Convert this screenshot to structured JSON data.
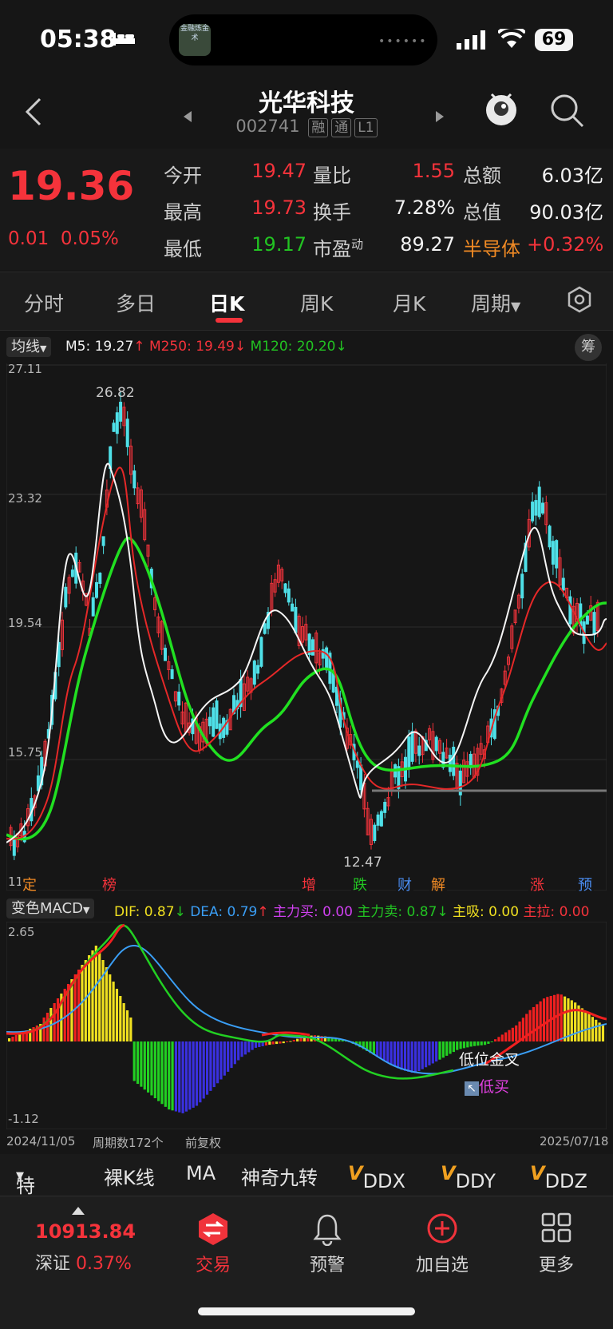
{
  "status": {
    "time": "05:38",
    "battery": "69",
    "island_app": "金融炼金术"
  },
  "header": {
    "title": "光华科技",
    "code": "002741",
    "tags": [
      "融",
      "通",
      "L1"
    ]
  },
  "quote": {
    "price": "19.36",
    "change": "0.01",
    "change_pct": "0.05%",
    "rows": [
      [
        "今开",
        "19.47",
        "量比",
        "1.55",
        "总额",
        "6.03亿"
      ],
      [
        "最高",
        "19.73",
        "换手",
        "7.28%",
        "总值",
        "90.03亿"
      ],
      [
        "最低",
        "19.17",
        "市盈",
        "89.27",
        "半导体",
        "+0.32%"
      ]
    ],
    "pe_sup": "动"
  },
  "tabs": [
    "分时",
    "多日",
    "日K",
    "周K",
    "月K",
    "周期"
  ],
  "active_tab": "日K",
  "ma_legend": {
    "selector": "均线",
    "m5": "M5: 19.27",
    "m250": "M250: 19.49",
    "m120": "M120: 20.20",
    "chip_button": "筹"
  },
  "kline": {
    "y_ticks": [
      "27.11",
      "23.32",
      "19.54",
      "15.75",
      "11"
    ],
    "max_label": "26.82",
    "min_label": "12.47",
    "events": [
      "定",
      "榜",
      "增",
      "跌",
      "财",
      "解",
      "涨",
      "预"
    ]
  },
  "macd_legend": {
    "selector": "变色MACD",
    "dif": "DIF: 0.87",
    "dea": "DEA: 0.79",
    "buy": "主力买: 0.00",
    "sell": "主力卖: 0.87",
    "absorb": "主吸: 0.00",
    "pull": "主拉: 0.00"
  },
  "macd": {
    "top": "2.65",
    "bottom": "-1.12",
    "signal_gold": "低位金叉",
    "signal_buy": "低买"
  },
  "footer_axis": {
    "start": "2024/11/05",
    "count": "周期数172个",
    "adjust": "前复权",
    "end": "2025/07/18"
  },
  "features": [
    "特色",
    "裸K线",
    "MA",
    "神奇九转",
    "DDX",
    "DDY",
    "DDZ"
  ],
  "index": {
    "value": "10913.84",
    "name": "深证",
    "pct": "0.37%"
  },
  "nav": [
    "交易",
    "预警",
    "加自选",
    "更多"
  ],
  "colors": {
    "up": "#f5333b",
    "down": "#22c322",
    "accent": "#f5333b"
  }
}
